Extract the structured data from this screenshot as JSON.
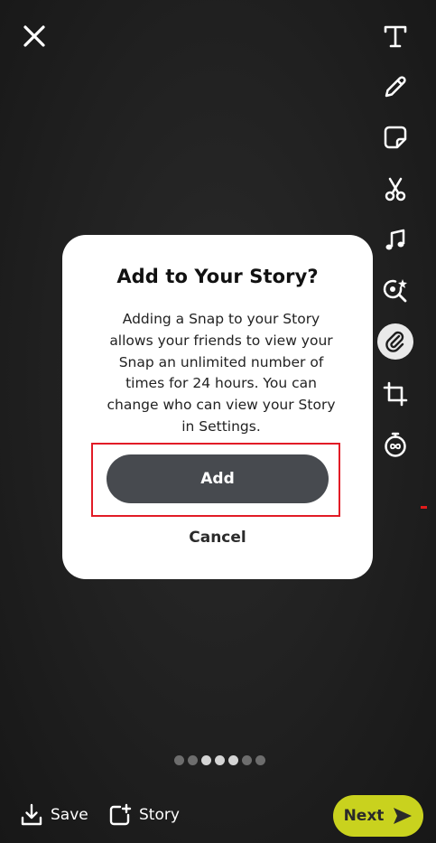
{
  "dialog": {
    "title": "Add to Your Story?",
    "body": "Adding a Snap to your Story allows your friends to view your Snap an unlimited number of times for 24 hours. You can change who can view your Story in Settings.",
    "add_label": "Add",
    "cancel_label": "Cancel"
  },
  "toolbar": {
    "icons": [
      "text-icon",
      "pencil-icon",
      "sticker-icon",
      "scissors-icon",
      "music-icon",
      "lens-icon",
      "paperclip-icon",
      "crop-icon",
      "timer-icon"
    ],
    "active": "paperclip-icon"
  },
  "pager": {
    "total": 7,
    "active": 3
  },
  "bottom": {
    "save_label": "Save",
    "story_label": "Story",
    "next_label": "Next"
  },
  "colors": {
    "next_button": "#c9d21e",
    "add_button": "#474a4f",
    "highlight": "#e21b26"
  }
}
